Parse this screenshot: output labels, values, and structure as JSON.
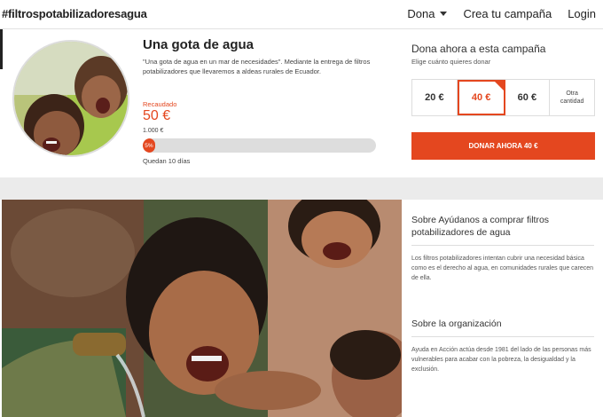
{
  "header": {
    "brand": "#filtrospotabilizadoresagua",
    "nav": {
      "donate": "Dona",
      "create": "Crea tu campaña",
      "login": "Login"
    }
  },
  "campaign": {
    "title": "Una gota de agua",
    "description": "\"Una gota de agua en un mar de necesidades\". Mediante la entrega de filtros potabilizadores que llevaremos a aldeas rurales de Ecuador.",
    "raised_label": "Recaudado",
    "raised_amount": "50 €",
    "goal": "1.000 €",
    "progress_label": "5%",
    "progress_fraction": 0.05,
    "days_left": "Quedan 10 días"
  },
  "donate": {
    "title": "Dona ahora a esta campaña",
    "subtitle": "Elige cuánto quieres donar",
    "amounts": [
      "20 €",
      "40 €",
      "60 €"
    ],
    "selected_index": 1,
    "other_line1": "Otra",
    "other_line2": "cantidad",
    "button": "DONAR AHORA 40 €",
    "accent": "#e4471f"
  },
  "about": {
    "heading": "Sobre Ayúdanos a comprar filtros potabilizadores de agua",
    "text": "Los filtros potabilizadores intentan cubrir una necesidad básica como es el derecho al agua, en comunidades rurales que carecen de ella.",
    "org_heading": "Sobre la organización",
    "org_text": "Ayuda en Acción actúa desde 1981 del lado de las personas más vulnerables para acabar con la pobreza, la desigualdad y la exclusión."
  }
}
